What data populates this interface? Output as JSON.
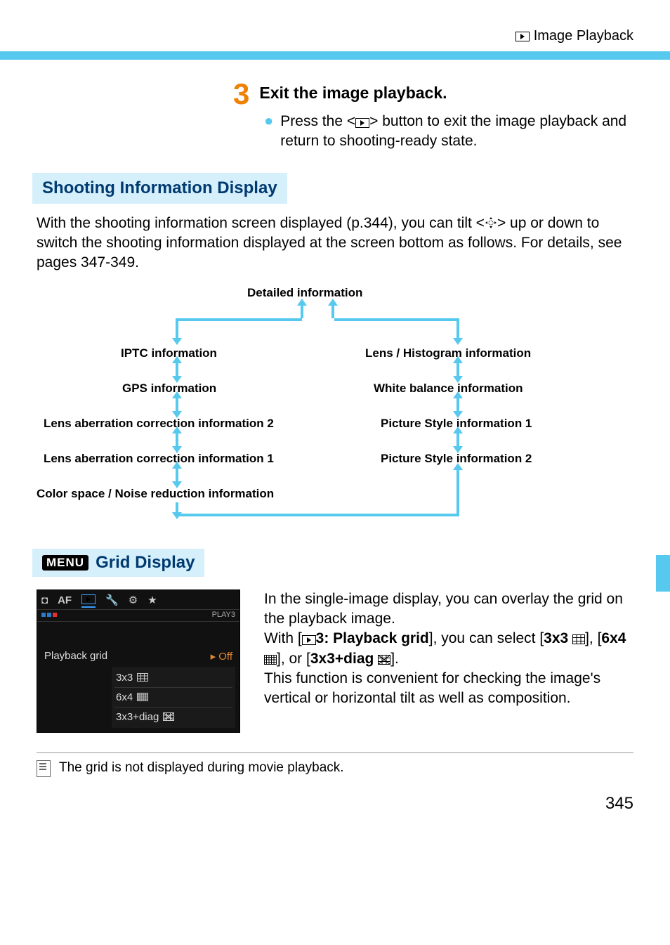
{
  "header": {
    "title": "Image Playback"
  },
  "step3": {
    "number": "3",
    "title": "Exit the image playback.",
    "bullet_pre": "Press the <",
    "bullet_post": "> button to exit the image playback and return to shooting-ready state."
  },
  "section1": {
    "heading": "Shooting Information Display",
    "intro_pre": "With the shooting information screen displayed (p.344), you can tilt <",
    "intro_post": "> up or down to switch the shooting information displayed at the screen bottom as follows. For details, see pages 347-349."
  },
  "diagram": {
    "top": "Detailed information",
    "left": [
      "IPTC information",
      "GPS information",
      "Lens aberration correction information 2",
      "Lens aberration correction information 1",
      "Color space / Noise reduction information"
    ],
    "right": [
      "Lens / Histogram information",
      "White balance information",
      "Picture Style information 1",
      "Picture Style information 2"
    ]
  },
  "section2": {
    "menu_label": "MENU",
    "heading": "Grid Display"
  },
  "screenshot": {
    "tab_playback_label": "PLAY3",
    "row_label": "Playback grid",
    "options": [
      "Off",
      "3x3",
      "6x4",
      "3x3+diag"
    ]
  },
  "grid_text": {
    "p1a": "In the single-image display, you can overlay the grid on the playback image.",
    "p2a": "With [",
    "p2b": "3: Playback grid",
    "p2c": "], you can select [",
    "p2d": "3x3",
    "p2e": "], [",
    "p2f": "6x4",
    "p2g": "], or [",
    "p2h": "3x3+diag",
    "p2i": "].",
    "p3": "This function is convenient for checking the image's vertical or horizontal tilt as well as composition."
  },
  "note": "The grid is not displayed during movie playback.",
  "page_number": "345"
}
